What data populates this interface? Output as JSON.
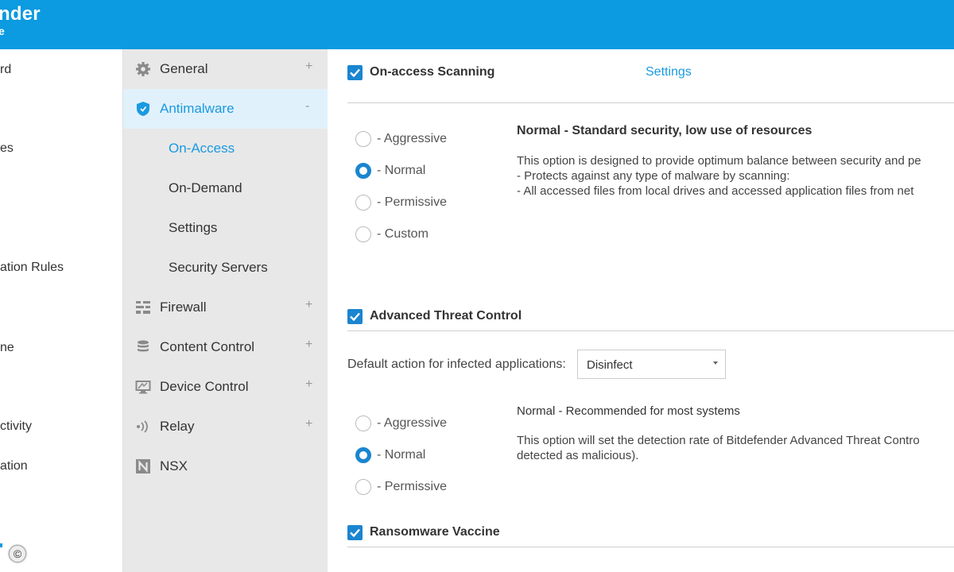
{
  "brand": {
    "line1": "nder",
    "line2": "e"
  },
  "left_nav": {
    "items": [
      {
        "label": "rd"
      },
      {
        "label": "es"
      },
      {
        "label": "ation Rules"
      },
      {
        "label": "ne"
      },
      {
        "label": "ctivity"
      },
      {
        "label": "ation"
      }
    ],
    "copyright": "©"
  },
  "sub_nav": {
    "sections": [
      {
        "label": "General",
        "toggle": "+",
        "icon": "gear-icon"
      },
      {
        "label": "Antimalware",
        "toggle": "-",
        "icon": "shield-icon"
      },
      {
        "label": "Firewall",
        "toggle": "+",
        "icon": "firewall-icon"
      },
      {
        "label": "Content Control",
        "toggle": "+",
        "icon": "database-icon"
      },
      {
        "label": "Device Control",
        "toggle": "+",
        "icon": "monitor-icon"
      },
      {
        "label": "Relay",
        "toggle": "+",
        "icon": "relay-icon"
      },
      {
        "label": "NSX",
        "icon": "nsx-icon"
      }
    ],
    "antimalware_items": [
      {
        "label": "On-Access"
      },
      {
        "label": "On-Demand"
      },
      {
        "label": "Settings"
      },
      {
        "label": "Security Servers"
      }
    ]
  },
  "on_access": {
    "title": "On-access Scanning",
    "settings_link": "Settings",
    "checked": true,
    "options": [
      {
        "label": "- Aggressive",
        "selected": false
      },
      {
        "label": "- Normal",
        "selected": true
      },
      {
        "label": "- Permissive",
        "selected": false
      },
      {
        "label": "- Custom",
        "selected": false
      }
    ],
    "desc_title": "Normal - Standard security, low use of resources",
    "desc_lines": [
      "This option is designed to provide optimum balance between security and pe",
      "- Protects against any type of malware by scanning:",
      "- All accessed files from local drives and accessed application files from net"
    ]
  },
  "atc": {
    "title": "Advanced Threat Control",
    "checked": true,
    "action_label": "Default action for infected applications:",
    "action_value": "Disinfect",
    "options": [
      {
        "label": "- Aggressive",
        "selected": false
      },
      {
        "label": "- Normal",
        "selected": true
      },
      {
        "label": "- Permissive",
        "selected": false
      }
    ],
    "desc_title": "Normal - Recommended for most systems",
    "desc_lines": [
      "This option will set the detection rate of Bitdefender Advanced Threat Contro",
      "detected as malicious)."
    ]
  },
  "ransomware": {
    "title": "Ransomware Vaccine",
    "checked": true
  },
  "colors": {
    "topbar": "#0c9ae0",
    "accent": "#1a85d0",
    "link": "#1a9ae0",
    "subnav_bg": "#e8e8e8",
    "active_row": "#e1f1fb"
  }
}
